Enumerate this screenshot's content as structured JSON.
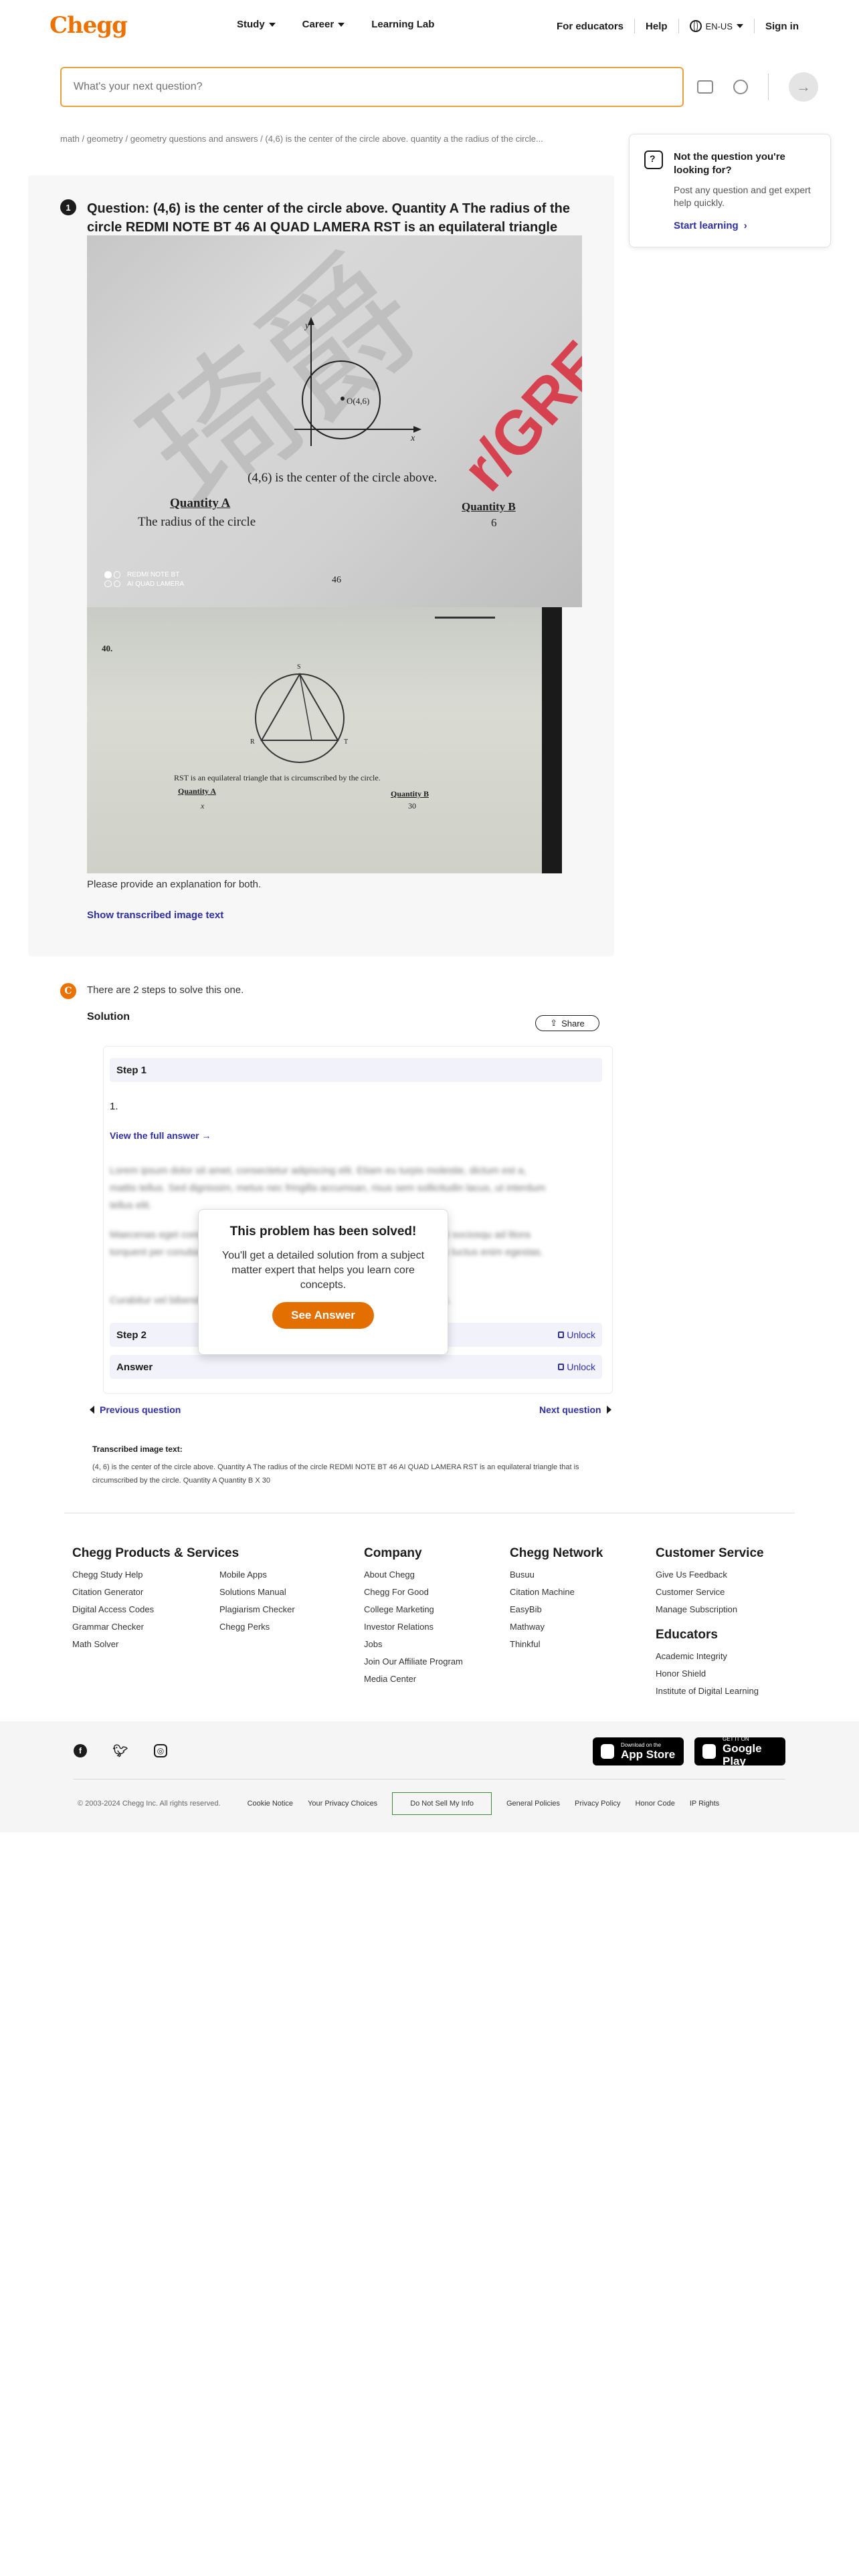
{
  "header": {
    "logo": "Chegg",
    "nav": [
      "Study",
      "Career",
      "Learning Lab"
    ],
    "for_educators": "For educators",
    "help": "Help",
    "locale": "EN-US",
    "sign_in": "Sign in"
  },
  "search": {
    "placeholder": "What's your next question?"
  },
  "breadcrumb": "math / geometry / geometry questions and answers / (4,6) is the center of the circle above. quantity a the radius of the circle...",
  "side": {
    "title": "Not the question you're looking for?",
    "text": "Post any question and get expert help quickly.",
    "link": "Start learning"
  },
  "question": {
    "number": "1",
    "title": "Question: (4,6) is the center of the circle above. Quantity A The radius of the circle REDMI NOTE BT 46 AI QUAD LAMERA RST is an equilateral triangle that...",
    "img1": {
      "watermark": "r/GREJa",
      "axis_y": "y",
      "axis_x": "x",
      "point": "O(4,6)",
      "caption": "(4,6) is the center of the circle above.",
      "qa_label": "Quantity A",
      "qa_text": "The radius of the circle",
      "qb_label": "Quantity B",
      "qb_value": "6",
      "phone_line1": "REDMI NOTE BT",
      "phone_line2": "AI QUAD LAMERA",
      "page": "46"
    },
    "img2": {
      "number": "40.",
      "vertex_top": "S",
      "vertex_left": "R",
      "vertex_right": "T",
      "caption": "RST is an equilateral triangle that is circumscribed by the circle.",
      "qa_label": "Quantity A",
      "qa_value": "x",
      "qb_label": "Quantity B",
      "qb_value": "30"
    },
    "description": "Please provide an explanation for both.",
    "show_transcribed": "Show transcribed image text"
  },
  "solution": {
    "intro": "There are 2 steps to solve this one.",
    "label": "Solution",
    "share": "Share",
    "step1": "Step 1",
    "step1_text": "1.",
    "view_full": "View the full answer →",
    "blur1": "Lorem ipsum dolor sit amet, consectetur adipiscing elit. Etiam eu turpis molestie, dictum est a, mattis tellus. Sed dignissim, metus nec fringilla accumsan, risus sem sollicitudin lacus, ut interdum tellus elit.",
    "blur2": "Maecenas eget condimentum velit, sit amet feugiat lectus. Class aptent taciti sociosqu ad litora torquent per conubia nostra, per inceptos himenaeos. Praesent auctor purus luctus enim egestas.",
    "blur3": "Curabitur vel bibendum lorem. Morbi convallis convallis diam sit amet lacinia.",
    "step2": "Step 2",
    "answer": "Answer",
    "unlock": "Unlock",
    "solved_title": "This problem has been solved!",
    "solved_text": "You'll get a detailed solution from a subject matter expert that helps you learn core concepts.",
    "see_answer": "See Answer",
    "prev": "Previous question",
    "next": "Next question"
  },
  "transcribed": {
    "label": "Transcribed image text:",
    "text": "(4, 6) is the center of the circle above. Quantity A The radius of the circle REDMI NOTE BT 46 AI QUAD LAMERA RST is an equilateral triangle that is circumscribed by the circle. Quantity A Quantity B X 30"
  },
  "footer": {
    "products": {
      "title": "Chegg Products & Services",
      "col1": [
        "Chegg Study Help",
        "Citation Generator",
        "Digital Access Codes",
        "Grammar Checker",
        "Math Solver"
      ],
      "col2": [
        "Mobile Apps",
        "Solutions Manual",
        "Plagiarism Checker",
        "Chegg Perks"
      ]
    },
    "company": {
      "title": "Company",
      "items": [
        "About Chegg",
        "Chegg For Good",
        "College Marketing",
        "Investor Relations",
        "Jobs",
        "Join Our Affiliate Program",
        "Media Center"
      ]
    },
    "network": {
      "title": "Chegg Network",
      "items": [
        "Busuu",
        "Citation Machine",
        "EasyBib",
        "Mathway",
        "Thinkful"
      ]
    },
    "service": {
      "title": "Customer Service",
      "items": [
        "Give Us Feedback",
        "Customer Service",
        "Manage Subscription"
      ]
    },
    "educators": {
      "title": "Educators",
      "items": [
        "Academic Integrity",
        "Honor Shield",
        "Institute of Digital Learning"
      ]
    },
    "appstore_small": "Download on the",
    "appstore_big": "App Store",
    "play_small": "GET IT ON",
    "play_big": "Google Play",
    "copyright": "© 2003-2024 Chegg Inc. All rights reserved.",
    "legal": [
      "Cookie Notice",
      "Your Privacy Choices",
      "Do Not Sell My Info",
      "General Policies",
      "Privacy Policy",
      "Honor Code",
      "IP Rights"
    ]
  },
  "colors": {
    "brand": "#eb7100",
    "link": "#2f2fa3",
    "search_border": "#e9a23b"
  }
}
